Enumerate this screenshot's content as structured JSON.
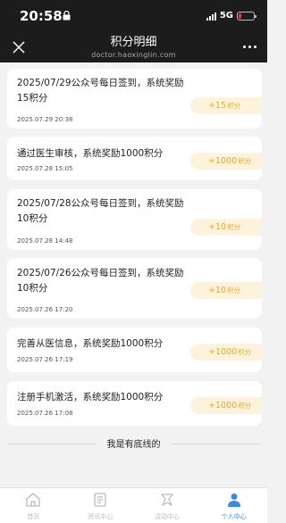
{
  "status_bar": {
    "time": "20:58",
    "network": "5G"
  },
  "header": {
    "title": "积分明细",
    "domain": "doctor.haoxinglin.com"
  },
  "records": [
    {
      "title": "2025/07/29公众号每日签到，系统奖励15积分",
      "time": "2025.07.29 20:38",
      "points": "+15",
      "unit": "积分"
    },
    {
      "title": "通过医生审核，系统奖励1000积分",
      "time": "2025.07.28 15:05",
      "points": "+1000",
      "unit": "积分"
    },
    {
      "title": "2025/07/28公众号每日签到，系统奖励10积分",
      "time": "2025.07.28 14:48",
      "points": "+10",
      "unit": "积分"
    },
    {
      "title": "2025/07/26公众号每日签到，系统奖励10积分",
      "time": "2025.07.26 17:20",
      "points": "+10",
      "unit": "积分"
    },
    {
      "title": "完善从医信息，系统奖励1000积分",
      "time": "2025.07.26 17:19",
      "points": "+1000",
      "unit": "积分"
    },
    {
      "title": "注册手机激活，系统奖励1000积分",
      "time": "2025.07.26 17:08",
      "points": "+1000",
      "unit": "积分"
    }
  ],
  "bottom_note": "我是有底线的",
  "tabs": [
    {
      "label": "首页",
      "icon": "home-icon"
    },
    {
      "label": "资讯中心",
      "icon": "news-icon"
    },
    {
      "label": "活动中心",
      "icon": "activity-icon"
    },
    {
      "label": "个人中心",
      "icon": "profile-icon"
    }
  ],
  "colors": {
    "accent": "#e5a92a",
    "badge_bg": "#fdf3dc",
    "active_tab": "#3a8be0",
    "header_bg": "#1c1c1c"
  }
}
